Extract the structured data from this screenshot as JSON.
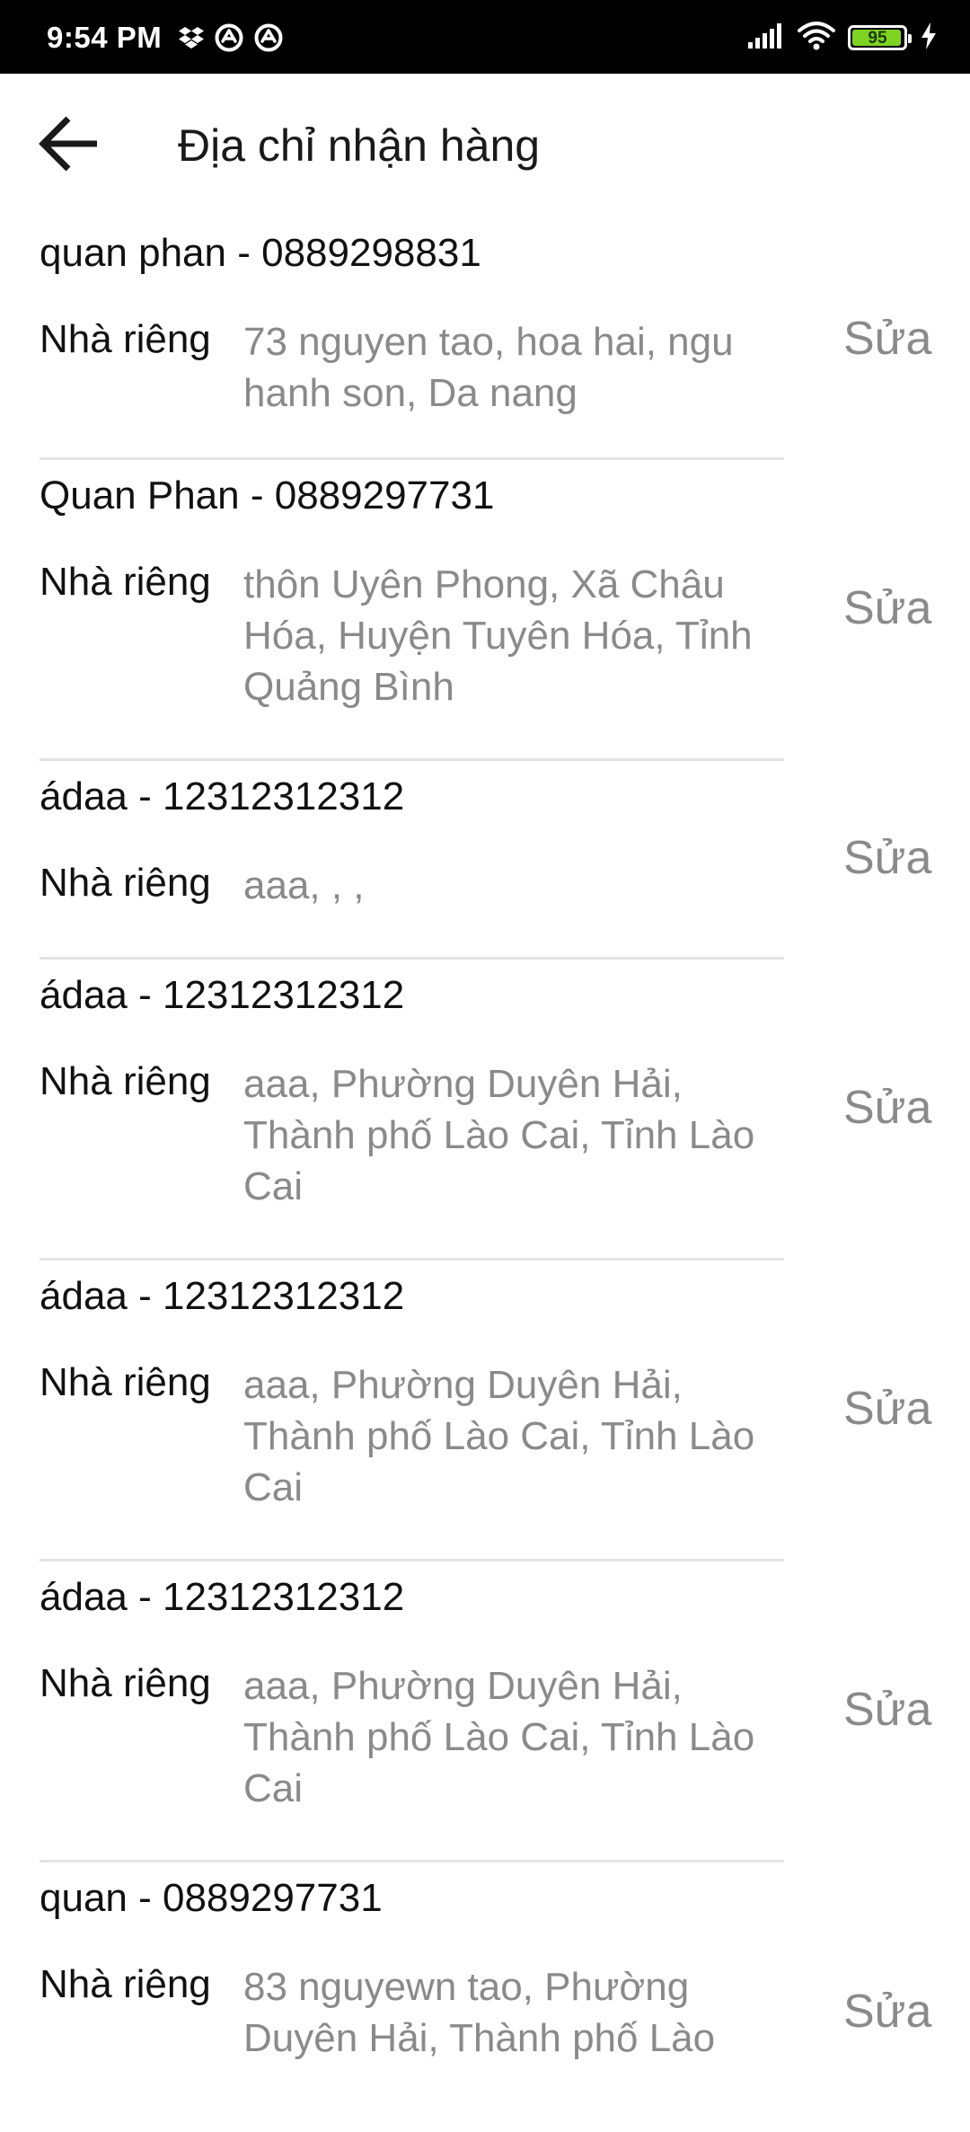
{
  "status_bar": {
    "time": "9:54 PM",
    "left_icons": [
      "dropbox-icon",
      "sync-icon",
      "sync-icon"
    ],
    "battery_level": "95"
  },
  "header": {
    "title": "Địa chỉ nhận hàng"
  },
  "addresses": [
    {
      "contact": "quan phan - 0889298831",
      "type": "Nhà riêng",
      "address": "73 nguyen tao, hoa hai, ngu hanh son, Da nang",
      "edit_label": "Sửa"
    },
    {
      "contact": "Quan Phan - 0889297731",
      "type": "Nhà riêng",
      "address": "thôn Uyên Phong, Xã Châu Hóa, Huyện Tuyên Hóa, Tỉnh Quảng Bình",
      "edit_label": "Sửa"
    },
    {
      "contact": "ádaa - 12312312312",
      "type": "Nhà riêng",
      "address": "aaa, , ,",
      "edit_label": "Sửa"
    },
    {
      "contact": "ádaa - 12312312312",
      "type": "Nhà riêng",
      "address": "aaa, Phường Duyên Hải, Thành phố Lào Cai, Tỉnh Lào Cai",
      "edit_label": "Sửa"
    },
    {
      "contact": "ádaa - 12312312312",
      "type": "Nhà riêng",
      "address": "aaa, Phường Duyên Hải, Thành phố Lào Cai, Tỉnh Lào Cai",
      "edit_label": "Sửa"
    },
    {
      "contact": "ádaa - 12312312312",
      "type": "Nhà riêng",
      "address": "aaa, Phường Duyên Hải, Thành phố Lào Cai, Tỉnh Lào Cai",
      "edit_label": "Sửa"
    },
    {
      "contact": "quan - 0889297731",
      "type": "Nhà riêng",
      "address": "83 nguyewn tao, Phường Duyên Hải, Thành phố Lào",
      "edit_label": "Sửa"
    }
  ]
}
